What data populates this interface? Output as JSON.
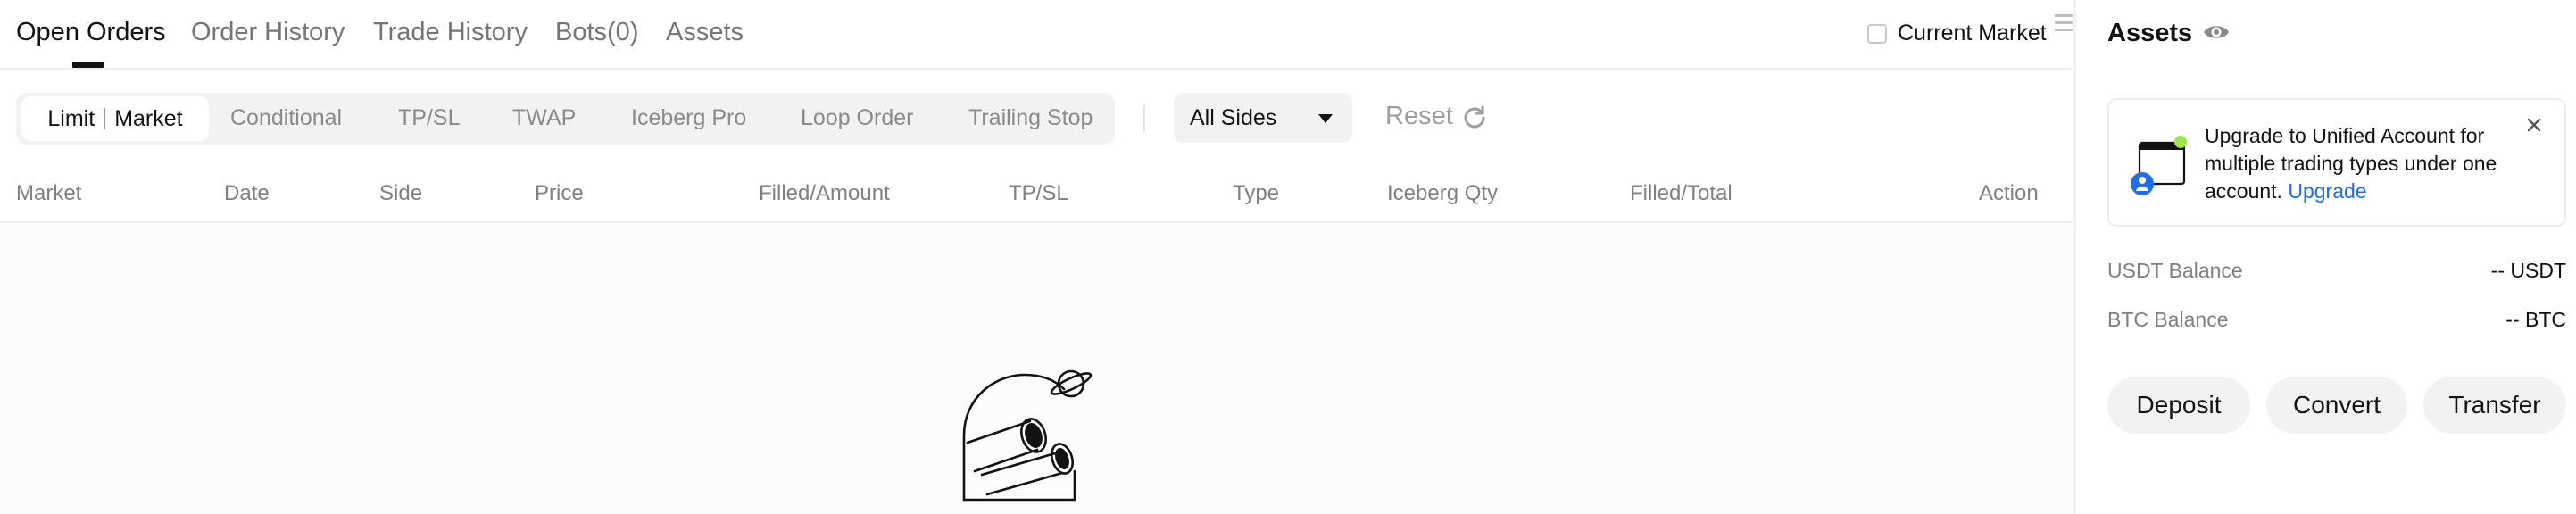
{
  "tabs": [
    {
      "label": "Open Orders"
    },
    {
      "label": "Order History"
    },
    {
      "label": "Trade History"
    },
    {
      "label": "Bots(0)"
    },
    {
      "label": "Assets"
    }
  ],
  "current_market_label": "Current Market",
  "order_types": {
    "active_left": "Limit",
    "active_right": "Market",
    "items": [
      "Conditional",
      "TP/SL",
      "TWAP",
      "Iceberg Pro",
      "Loop Order",
      "Trailing Stop"
    ]
  },
  "sides_select": {
    "value": "All Sides"
  },
  "reset_label": "Reset",
  "table": {
    "columns": [
      "Market",
      "Date",
      "Side",
      "Price",
      "Filled/Amount",
      "TP/SL",
      "Type",
      "Iceberg Qty",
      "Filled/Total",
      "Action"
    ]
  },
  "assets_panel": {
    "title": "Assets",
    "banner": {
      "text": "Upgrade to Unified Account for multiple trading types under one account.",
      "link": "Upgrade"
    },
    "balances": [
      {
        "label": "USDT Balance",
        "value": "-- USDT"
      },
      {
        "label": "BTC Balance",
        "value": "-- BTC"
      }
    ],
    "buttons": [
      "Deposit",
      "Convert",
      "Transfer"
    ]
  },
  "colors": {
    "accent_link": "#1e6fe8",
    "text_primary": "#121212",
    "text_muted": "#808080",
    "surface": "#f2f2f2",
    "badge_green": "#9be84b"
  }
}
